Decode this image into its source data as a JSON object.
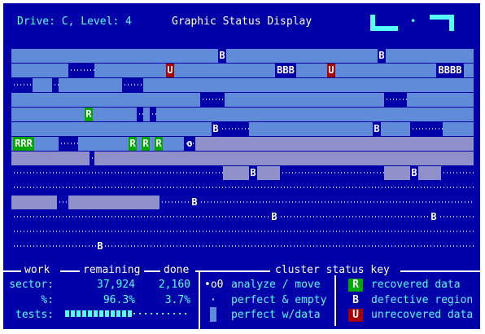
{
  "header": {
    "drive": "Drive: C, Level: 4",
    "title": "Graphic Status Display"
  },
  "panel": {
    "work": "work",
    "remaining": "remaining",
    "done": "done",
    "key_title": "cluster status key",
    "sector_label": "sector:",
    "sector_remaining": "37,924",
    "sector_done": "2,160",
    "pct_label": "%:",
    "pct_remaining": "96.3%",
    "pct_done": "3.7%",
    "tests_label": "tests:",
    "tests_progress": 0.55
  },
  "key": {
    "analyze_sym": "•o0",
    "analyze": "analyze / move",
    "empty_sym": "·",
    "empty": "perfect & empty",
    "data": "perfect w/data",
    "recovered_sym": "R",
    "recovered": "recovered data",
    "defective_sym": "B",
    "defective": "defective region",
    "unrecovered_sym": "U",
    "unrecovered": "unrecovered data"
  },
  "colors": {
    "background": "#0000a8",
    "data": "#5f8bd9",
    "recovered": "#00a800",
    "unrecovered": "#a80000",
    "text": "#55ffff"
  },
  "map_markers": {
    "B": "B",
    "BBB": "BBB",
    "BBBB": "BBBB",
    "U": "U",
    "R": "R",
    "RRR": "RRR",
    "o": "o"
  }
}
